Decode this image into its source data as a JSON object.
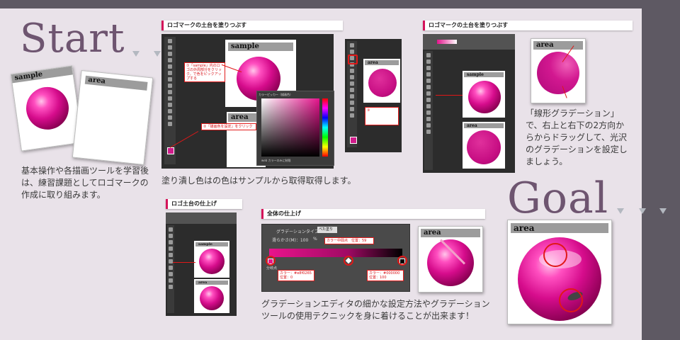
{
  "intro": {
    "start_title": "Start",
    "goal_title": "Goal",
    "start_caption": "基本操作や各描画ツールを学習後は、練習課題としてロゴマークの作成に取り組みます。"
  },
  "start_cards": {
    "sample": "sample",
    "area": "area"
  },
  "panel1": {
    "heading": "ロゴマークの土台を塗りつぶす",
    "card_sample": "sample",
    "card_area": "area",
    "note1": "①「sample」内のロゴの外周部分をクリック。で色をピックアップする",
    "note2": "②「描画色を設定」をクリック",
    "picker_title": "カラーピッカー（描画色）",
    "picker_footer": "web カラーのみに制限",
    "caption": "塗り潰し色はの色はサンプルから取得取得します。"
  },
  "panel1b": {
    "card_area": "area",
    "note": "③ "
  },
  "panel2": {
    "heading": "ロゴマークの土台を塗りつぶす",
    "card_area": "area",
    "card_sample": "sample",
    "inner_area": "area",
    "caption": "「線形グラデーション」で、右上と右下の2方向からからドラッグして、光沢のグラデーションを設定しましょう。"
  },
  "panel3": {
    "heading": "ロゴ土台の仕上げ",
    "card_sample": "sample",
    "card_area": "area"
  },
  "panel4": {
    "heading": "全体の仕上げ",
    "grad_type_label": "グラデーションタイプ：",
    "grad_type_value": "べた塗り",
    "smooth_label": "滑らかさ(M)：100",
    "smooth_unit": "%",
    "stop_mid": "カラー中間点　位置：59",
    "stop_left_color": "カラー：#e8f0265",
    "stop_left_pos": "位置：0",
    "stop_right_color": "カラー：#000000",
    "stop_right_pos": "位置：100",
    "stop_group": "分岐点",
    "card_area": "area",
    "caption": "グラデーションエディタの細かな設定方法やグラデーションツールの使用テクニックを身に着けることが出来ます！"
  },
  "goal_card": {
    "area": "area"
  },
  "colors": {
    "accent": "#d4145a",
    "frame": "#5e5963",
    "bg": "#e9e2e9"
  }
}
